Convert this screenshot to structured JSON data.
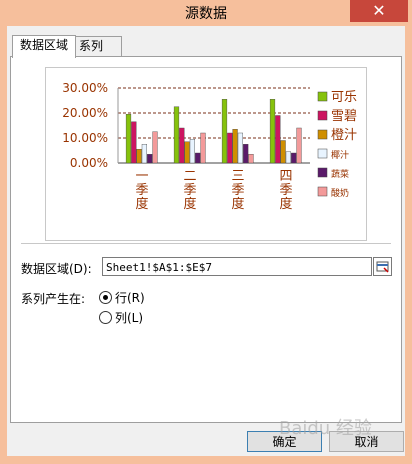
{
  "window": {
    "title": "源数据",
    "close_glyph": "✕"
  },
  "tabs": [
    {
      "label": "数据区域",
      "active": true
    },
    {
      "label": "系列",
      "active": false
    }
  ],
  "chart_data": {
    "type": "bar",
    "categories": [
      "一季度",
      "二季度",
      "三季度",
      "四季度"
    ],
    "y_ticks": [
      "30.00%",
      "20.00%",
      "10.00%",
      "0.00%"
    ],
    "ylim": [
      0,
      0.3
    ],
    "grid": true,
    "legend_position": "right",
    "series": [
      {
        "name": "可乐",
        "color": "#86c20c",
        "values": [
          0.195,
          0.225,
          0.255,
          0.255
        ]
      },
      {
        "name": "雪碧",
        "color": "#cc1560",
        "values": [
          0.165,
          0.14,
          0.12,
          0.19
        ]
      },
      {
        "name": "橙汁",
        "color": "#cf8f00",
        "values": [
          0.055,
          0.085,
          0.135,
          0.09
        ]
      },
      {
        "name": "椰汁",
        "color": "#e8f4ff",
        "values": [
          0.075,
          0.095,
          0.12,
          0.045
        ]
      },
      {
        "name": "蔬菜",
        "color": "#5a1a6a",
        "values": [
          0.035,
          0.04,
          0.075,
          0.04
        ]
      },
      {
        "name": "酸奶",
        "color": "#f39a9a",
        "values": [
          0.125,
          0.12,
          0.035,
          0.14
        ]
      }
    ]
  },
  "form": {
    "range_label": "数据区域(D):",
    "range_value": "Sheet1!$A$1:$E$7",
    "series_in_label": "系列产生在:",
    "options": [
      {
        "label": "行(R)",
        "selected": true
      },
      {
        "label": "列(L)",
        "selected": false
      }
    ]
  },
  "buttons": {
    "ok": "确定",
    "cancel": "取消"
  },
  "watermark": "Baidu 经验"
}
